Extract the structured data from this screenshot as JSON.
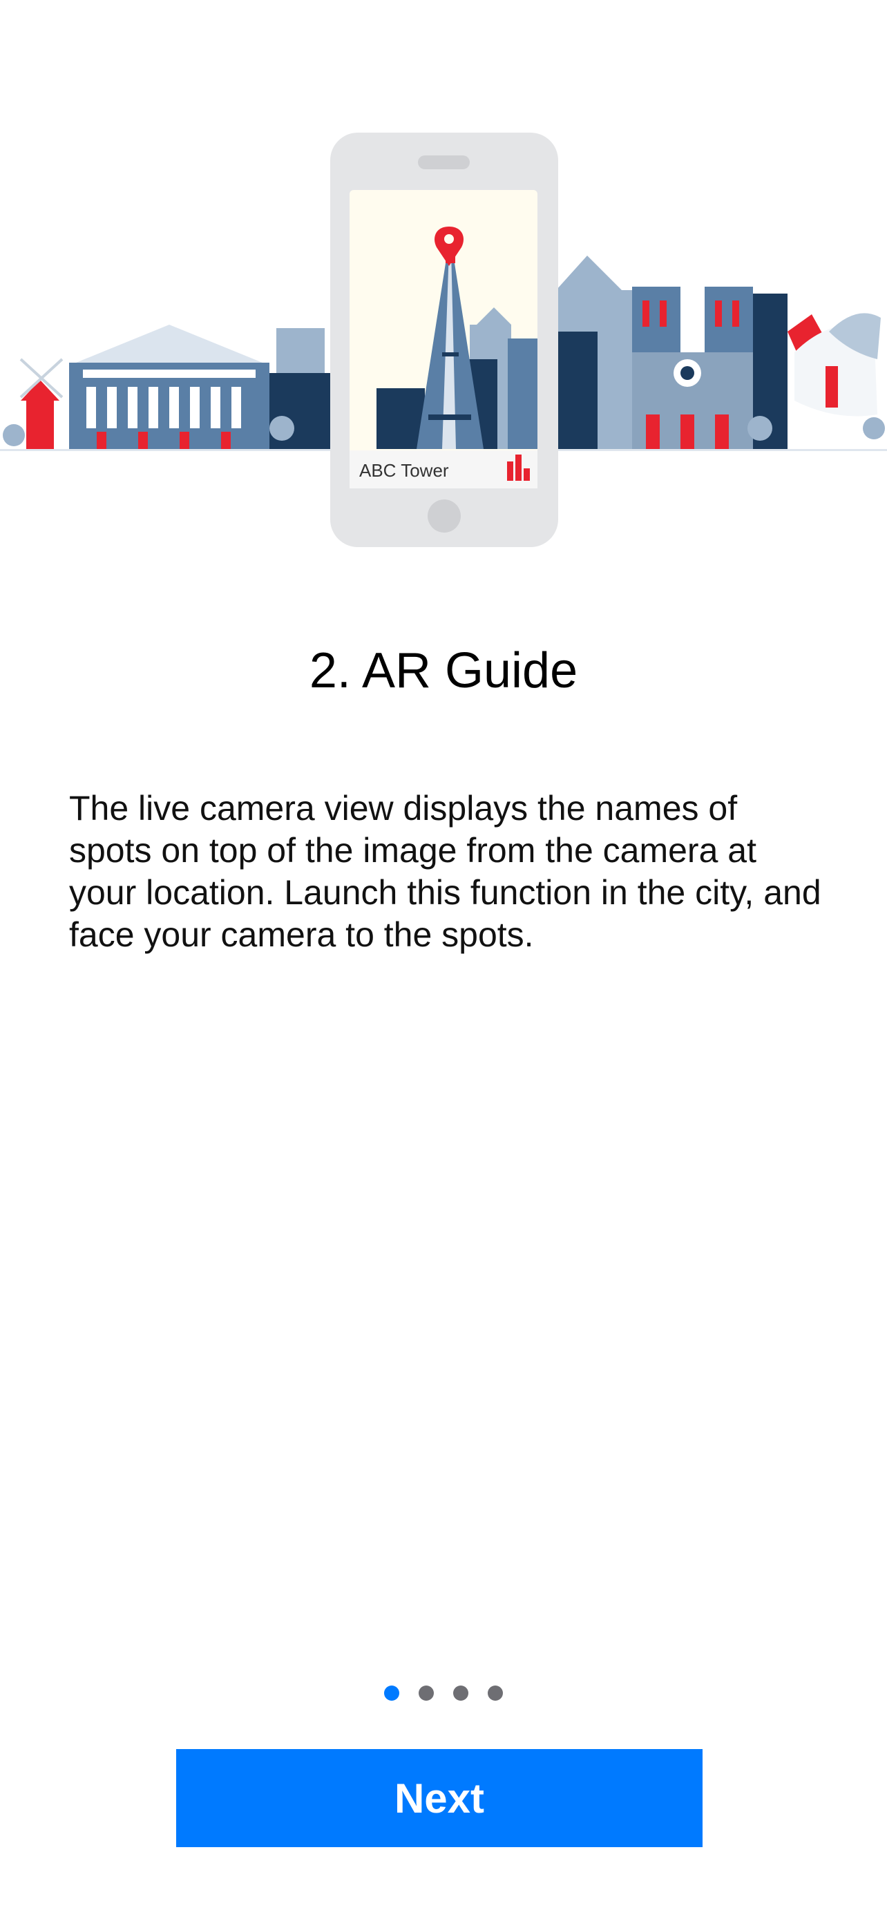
{
  "illustration": {
    "phone_label": "ABC Tower",
    "chart_icon": "bar-chart-icon",
    "pin_icon": "location-pin-icon",
    "accent_color": "#e8232f",
    "navy_color": "#1b3a5c"
  },
  "onboarding": {
    "title": "2. AR Guide",
    "description": "The live camera view displays the names of spots on top of the image from the camera at your location. Launch this function in the city, and face your camera to the spots.",
    "current_page": 1,
    "total_pages": 4
  },
  "actions": {
    "next_label": "Next",
    "primary_color": "#007aff"
  }
}
